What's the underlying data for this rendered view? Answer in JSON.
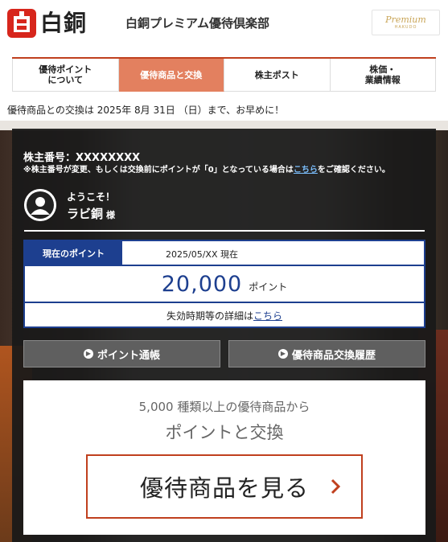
{
  "header": {
    "logo_text": "白銅",
    "site_name": "白銅プレミアム優待倶楽部",
    "premium_badge": {
      "main": "Premium",
      "sub": "HAKUDO"
    }
  },
  "nav": {
    "items": [
      {
        "label": "優待ポイント\nについて",
        "active": false
      },
      {
        "label": "優待商品と交換",
        "active": true
      },
      {
        "label": "株主ポスト",
        "active": false
      },
      {
        "label": "株価・\n業績情報",
        "active": false
      }
    ]
  },
  "notice": "優待商品との交換は 2025年 8月 31日 （日）まで、お早めに！",
  "member": {
    "number_label": "株主番号：XXXXXXXX",
    "note_before": "※株主番号が変更、もしくは交換前にポイントが「0」となっている場合は",
    "note_link": "こちら",
    "note_after": "をご確認ください。",
    "welcome": "ようこそ！",
    "name": "ラビ銅",
    "honorific": "様"
  },
  "points": {
    "label": "現在のポイント",
    "as_of": "2025/05/XX 現在",
    "value": "20,000",
    "unit": "ポイント",
    "expiry_text": "失効時期等の詳細は",
    "expiry_link": "こちら"
  },
  "buttons": {
    "passbook": "ポイント通帳",
    "history": "優待商品交換履歴"
  },
  "catalog": {
    "line1": "5,000 種類以上の優待商品から",
    "line2": "ポイントと交換",
    "cta": "優待商品を見る"
  },
  "colors": {
    "accent_red": "#c0401e",
    "nav_active": "#e3805f",
    "navy": "#1d3f8f"
  }
}
